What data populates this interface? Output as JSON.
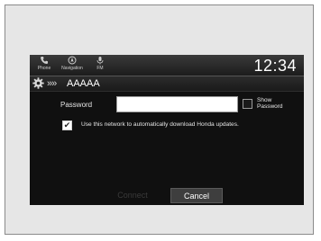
{
  "topbar": {
    "items": [
      {
        "label": "Phone",
        "icon": "phone-icon"
      },
      {
        "label": "Navigation",
        "icon": "navigation-icon"
      },
      {
        "label": "FM",
        "icon": "fm-radio-icon"
      }
    ],
    "clock": "12:34"
  },
  "network": {
    "settings_icon": "gear-icon",
    "chevron_icon": "double-chevron-icon",
    "chevron_glyph": "»»",
    "ssid": "AAAAA"
  },
  "form": {
    "password_label": "Password",
    "password_value": "",
    "show_password_label_line1": "Show",
    "show_password_label_line2": "Password",
    "show_password_checked": false,
    "auto_download_label": "Use this network to automatically download Honda updates.",
    "auto_download_checked": true,
    "check_glyph": "✔"
  },
  "buttons": {
    "connect": "Connect",
    "cancel": "Cancel"
  },
  "colors": {
    "screen_bg": "#101010",
    "frame_bg": "#e6e6e6",
    "text": "#e6e6e6",
    "button_bg": "#3e3e3e"
  }
}
